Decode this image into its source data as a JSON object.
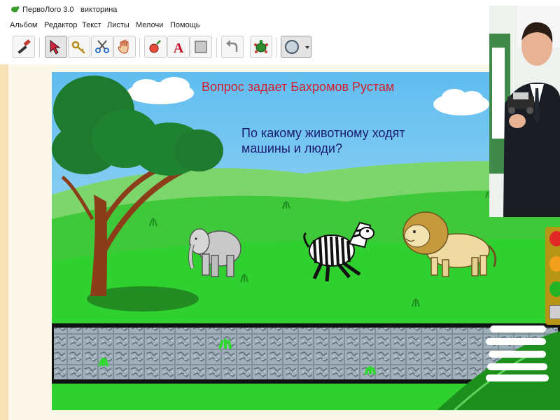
{
  "window": {
    "app_name": "ПервоЛого 3.0",
    "document_name": "викторина"
  },
  "menu": {
    "items": [
      "Альбом",
      "Редактор",
      "Текст",
      "Листы",
      "Мелочи",
      "Помощь"
    ]
  },
  "toolbar": {
    "buttons": [
      {
        "name": "paint-brush-icon"
      },
      {
        "name": "pointer-arrow-icon",
        "active": true
      },
      {
        "name": "key-icon"
      },
      {
        "name": "scissors-icon"
      },
      {
        "name": "hand-icon"
      },
      {
        "name": "shape-tool-icon"
      },
      {
        "name": "text-tool-icon",
        "glyph": "A"
      },
      {
        "name": "new-page-icon"
      },
      {
        "name": "undo-icon"
      },
      {
        "name": "turtle-icon"
      },
      {
        "name": "circle-shape-icon"
      }
    ]
  },
  "canvas": {
    "question_author": "Вопрос задает Бахромов Рустам",
    "question": "По какому животному ходят\nмашины и люди?",
    "animals": [
      "elephant",
      "zebra",
      "lion"
    ]
  },
  "colors": {
    "title_red": "#d21e2f",
    "question_blue": "#1a1a70",
    "sky_top": "#5fbdef",
    "grass": "#2fd02f",
    "panel_cream": "#f6e2b6"
  }
}
